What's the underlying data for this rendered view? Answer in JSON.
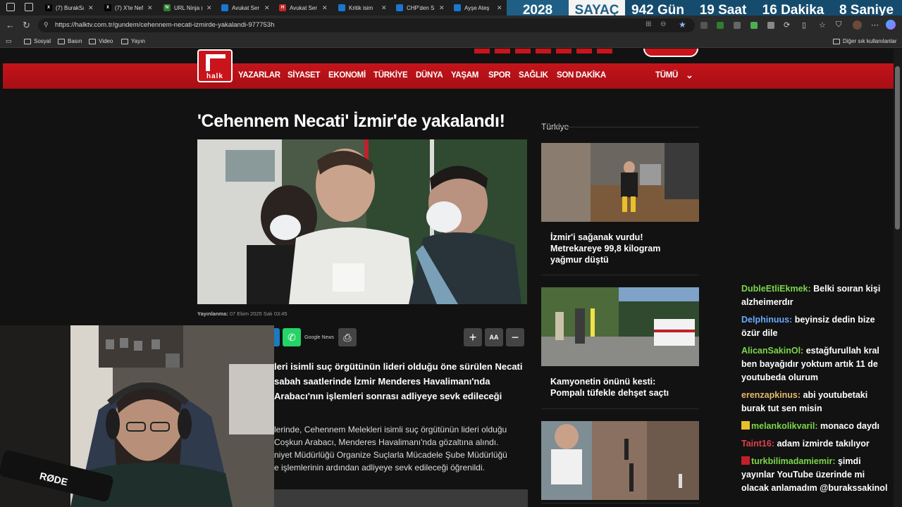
{
  "browser": {
    "tabs": [
      {
        "title": "(7) BurakSa",
        "icon": "x-logo",
        "color": "#000000",
        "glyph": "X"
      },
      {
        "title": "(7) X'te Nef",
        "icon": "x-logo",
        "color": "#000000",
        "glyph": "X"
      },
      {
        "title": "URL Ninja (",
        "icon": "ninja-icon",
        "color": "#2e7d32",
        "glyph": "N"
      },
      {
        "title": "Avukat Ser",
        "icon": "t24-icon",
        "color": "#1976d2",
        "glyph": "T24"
      },
      {
        "title": "Avukat Ser",
        "icon": "haber-icon",
        "color": "#c62828",
        "glyph": "H"
      },
      {
        "title": "Kritik isim",
        "icon": "t24-icon",
        "color": "#1976d2",
        "glyph": "T24"
      },
      {
        "title": "CHP'den S",
        "icon": "t24-icon",
        "color": "#1976d2",
        "glyph": "T24"
      },
      {
        "title": "Ayşe Ateş",
        "icon": "t24-icon",
        "color": "#1976d2",
        "glyph": "T24"
      }
    ],
    "url": "https://halktv.com.tr/gundem/cehennem-necati-izmirde-yakalandi-977753h",
    "bookmarks": [
      "Sosyal",
      "Basın",
      "Video",
      "Yayın"
    ],
    "other_bookmarks": "Diğer sık kullanılanlar"
  },
  "counter": {
    "year": "2028",
    "label": "SAYAÇ",
    "days": "942 Gün",
    "hours": "19 Saat",
    "minutes": "16 Dakika",
    "seconds": "8 Saniye"
  },
  "site": {
    "logo_text": "halk",
    "nav": [
      "YAZARLAR",
      "SİYASET",
      "EKONOMİ",
      "TÜRKİYE",
      "DÜNYA",
      "YAŞAM",
      "SPOR",
      "SAĞLIK",
      "SON DAKİKA"
    ],
    "nav_all": "TÜMÜ",
    "colors": {
      "brand_red": "#c8141a",
      "whatsapp": "#25d366"
    }
  },
  "article": {
    "title": "'Cehennem Necati' İzmir'de yakalandı!",
    "published_label": "Yayınlanma:",
    "published_date": "07 Ekim 2025 Salı 03:45",
    "google_news": "Google News",
    "font_size_label": "AA",
    "lead_lines": [
      "leri isimli suç örgütünün lideri olduğu öne sürülen Necati",
      "sabah saatlerinde İzmir Menderes Havalimanı'nda",
      "Arabacı'nın işlemleri sonrası adliyeye sevk edileceği"
    ],
    "body_lines": [
      "lerinde, Cehennem Melekleri isimli suç örgütünün lideri olduğu",
      "Coşkun Arabacı, Menderes Havalimanı'nda gözaltına alındı.",
      "niyet Müdürlüğü Organize Suçlarla Mücadele Şube Müdürlüğü",
      "e işlemlerinin ardından adliyeye sevk edileceği öğrenildi."
    ]
  },
  "sidebar": {
    "heading": "Türkiye",
    "cards": [
      {
        "title": "İzmir'i sağanak vurdu! Metrekareye 99,8 kilogram yağmur düştü"
      },
      {
        "title": "Kamyonetin önünü kesti: Pompalı tüfekle dehşet saçtı"
      },
      {
        "title": ""
      }
    ]
  },
  "webcam": {
    "mic_brand": "RØDE"
  },
  "chat": [
    {
      "user": "DubleEtliEkmek:",
      "text": "Belki soıran kişi alzheimerdır",
      "color": "#7cd64a"
    },
    {
      "user": "Delphinuus:",
      "text": "beyinsiz dedin bize özür dile",
      "color": "#6aa8ff"
    },
    {
      "user": "AlicanSakinOl:",
      "text": "estağfurullah kral ben bayağıdır yoktum artık 11 de youtubeda olurum",
      "color": "#7cd64a"
    },
    {
      "user": "erenzapkinus:",
      "text": "abi youtubetaki burak tut sen misin",
      "color": "#e8b86c"
    },
    {
      "user": "melankolikvaril:",
      "text": "monaco daydı",
      "color": "#7cd64a",
      "badge": true
    },
    {
      "user": "Taint16:",
      "text": "adam izmirde takılıyor",
      "color": "#e0414b"
    },
    {
      "user": "turkbilimadamiemir:",
      "text": "şimdi yayınlar YouTube üzerinde mi olacak anlamadım @burakssakinol",
      "color": "#7cd64a",
      "badge": true
    }
  ]
}
